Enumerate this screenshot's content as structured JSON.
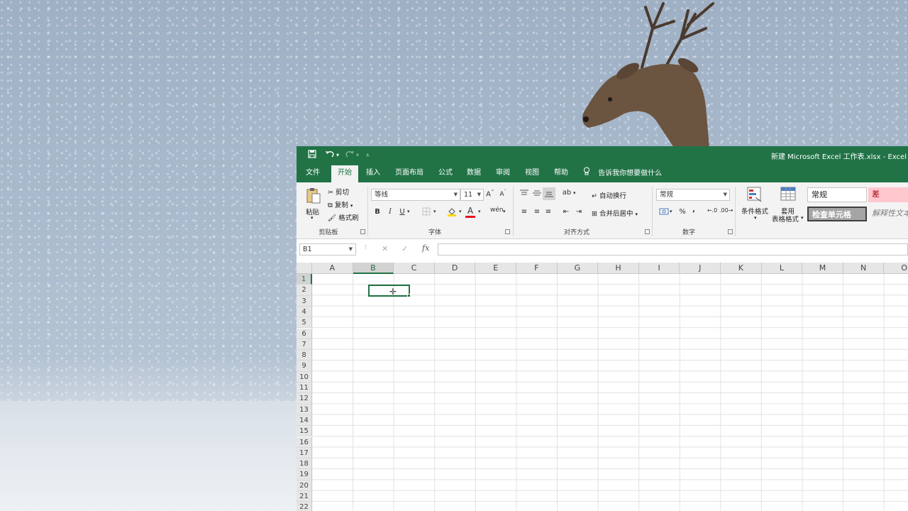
{
  "window": {
    "title": "新建 Microsoft Excel 工作表.xlsx  -  Excel"
  },
  "quick_access": {
    "save_icon": "save-icon",
    "undo_icon": "undo-icon",
    "redo_icon": "redo-icon",
    "customize_icon": "customize-qat-icon"
  },
  "tabs": [
    {
      "label": "文件",
      "active": false
    },
    {
      "label": "开始",
      "active": true
    },
    {
      "label": "插入",
      "active": false
    },
    {
      "label": "页面布局",
      "active": false
    },
    {
      "label": "公式",
      "active": false
    },
    {
      "label": "数据",
      "active": false
    },
    {
      "label": "审阅",
      "active": false
    },
    {
      "label": "视图",
      "active": false
    },
    {
      "label": "帮助",
      "active": false
    }
  ],
  "tell_me": "告诉我你想要做什么",
  "ribbon": {
    "clipboard": {
      "label": "剪贴板",
      "paste": "粘贴",
      "cut": "剪切",
      "copy": "复制",
      "format_painter": "格式刷"
    },
    "font": {
      "label": "字体",
      "font_name": "等线",
      "font_size": "11",
      "bold": "B",
      "italic": "I",
      "underline": "U",
      "font_color": "#e81123"
    },
    "alignment": {
      "label": "对齐方式",
      "wrap_text": "自动换行",
      "merge_center": "合并后居中"
    },
    "number": {
      "label": "数字",
      "format": "常规",
      "percent": "%",
      "comma": ","
    },
    "styles": {
      "conditional_format": "条件格式",
      "format_as_table_1": "套用",
      "format_as_table_2": "表格格式",
      "normal": "常规",
      "bad": "差",
      "check_cell": "检查单元格",
      "explanatory": "解释性文本"
    }
  },
  "formula_bar": {
    "name_box": "B1",
    "cancel": "✕",
    "enter": "✓",
    "fx": "fx",
    "content": ""
  },
  "sheet": {
    "columns": [
      "A",
      "B",
      "C",
      "D",
      "E",
      "F",
      "G",
      "H",
      "I",
      "J",
      "K",
      "L",
      "M",
      "N",
      "O"
    ],
    "rows": [
      "1",
      "2",
      "3",
      "4",
      "5",
      "6",
      "7",
      "8",
      "9",
      "10",
      "11",
      "12",
      "13",
      "14",
      "15",
      "16",
      "17",
      "18",
      "19",
      "20",
      "21",
      "22"
    ],
    "selected_cell": "B1",
    "accent_color": "#217346"
  }
}
